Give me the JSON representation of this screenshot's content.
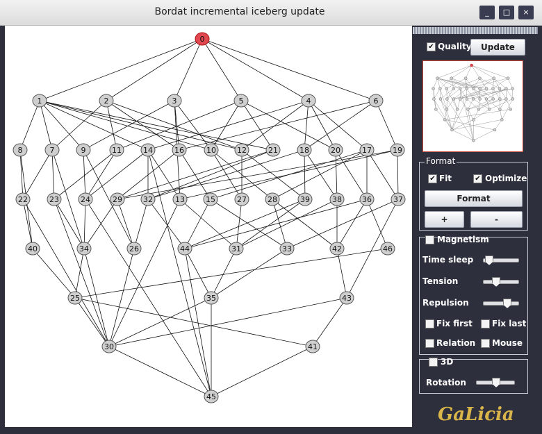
{
  "window": {
    "title": "Bordat incremental iceberg update"
  },
  "toolbar": {
    "quality_label": "Quality",
    "quality_checked": true,
    "update_label": "Update"
  },
  "format": {
    "legend": "Format",
    "fit_label": "Fit",
    "fit_checked": true,
    "optimize_label": "Optimize",
    "optimize_checked": true,
    "format_button": "Format",
    "plus_button": "+",
    "minus_button": "-"
  },
  "magnetism": {
    "legend": "Magnetism",
    "checked": false,
    "time_sleep_label": "Time sleep",
    "time_sleep_value": 0.05,
    "tension_label": "Tension",
    "tension_value": 0.3,
    "repulsion_label": "Repulsion",
    "repulsion_value": 0.7,
    "fix_first_label": "Fix first",
    "fix_last_label": "Fix last",
    "relation_label": "Relation",
    "mouse_label": "Mouse"
  },
  "threed": {
    "legend": "3D",
    "checked": false,
    "rotation_label": "Rotation",
    "rotation_value": 0.5
  },
  "logo": "GaLicia",
  "colors": {
    "selected_node": "#e0474f",
    "node": "#cfcfcf",
    "panel_bg": "#2d2f3c"
  },
  "lattice": {
    "levels": [
      [
        "0"
      ],
      [
        "1",
        "2",
        "3",
        "5",
        "4",
        "6"
      ],
      [
        "8",
        "7",
        "9",
        "11",
        "14",
        "16",
        "10",
        "12",
        "21",
        "18",
        "20",
        "17",
        "19"
      ],
      [
        "22",
        "23",
        "24",
        "29",
        "32",
        "13",
        "15",
        "27",
        "28",
        "39",
        "38",
        "36",
        "37"
      ],
      [
        "40",
        "34",
        "26",
        "44",
        "31",
        "33",
        "42",
        "46"
      ],
      [
        "25",
        "35",
        "43"
      ],
      [
        "30",
        "41"
      ],
      [
        "45"
      ]
    ],
    "selected": "0",
    "edges": [
      [
        "0",
        "1"
      ],
      [
        "0",
        "2"
      ],
      [
        "0",
        "3"
      ],
      [
        "0",
        "5"
      ],
      [
        "0",
        "4"
      ],
      [
        "0",
        "6"
      ],
      [
        "1",
        "8"
      ],
      [
        "1",
        "7"
      ],
      [
        "1",
        "9"
      ],
      [
        "1",
        "14"
      ],
      [
        "1",
        "10"
      ],
      [
        "1",
        "12"
      ],
      [
        "1",
        "21"
      ],
      [
        "2",
        "7"
      ],
      [
        "2",
        "11"
      ],
      [
        "2",
        "16"
      ],
      [
        "2",
        "12"
      ],
      [
        "3",
        "9"
      ],
      [
        "3",
        "16"
      ],
      [
        "3",
        "10"
      ],
      [
        "3",
        "13"
      ],
      [
        "5",
        "11"
      ],
      [
        "5",
        "10"
      ],
      [
        "5",
        "21"
      ],
      [
        "5",
        "20"
      ],
      [
        "4",
        "14"
      ],
      [
        "4",
        "12"
      ],
      [
        "4",
        "18"
      ],
      [
        "4",
        "20"
      ],
      [
        "4",
        "17"
      ],
      [
        "6",
        "16"
      ],
      [
        "6",
        "18"
      ],
      [
        "6",
        "19"
      ],
      [
        "8",
        "22"
      ],
      [
        "8",
        "40"
      ],
      [
        "7",
        "22"
      ],
      [
        "7",
        "23"
      ],
      [
        "7",
        "34"
      ],
      [
        "9",
        "24"
      ],
      [
        "9",
        "26"
      ],
      [
        "11",
        "23"
      ],
      [
        "11",
        "24"
      ],
      [
        "14",
        "24"
      ],
      [
        "14",
        "32"
      ],
      [
        "14",
        "13"
      ],
      [
        "16",
        "29"
      ],
      [
        "16",
        "15"
      ],
      [
        "10",
        "27"
      ],
      [
        "10",
        "28"
      ],
      [
        "12",
        "27"
      ],
      [
        "12",
        "39"
      ],
      [
        "21",
        "29"
      ],
      [
        "21",
        "32"
      ],
      [
        "18",
        "32"
      ],
      [
        "18",
        "39"
      ],
      [
        "18",
        "38"
      ],
      [
        "20",
        "38"
      ],
      [
        "20",
        "36"
      ],
      [
        "17",
        "28"
      ],
      [
        "17",
        "15"
      ],
      [
        "17",
        "36"
      ],
      [
        "17",
        "37"
      ],
      [
        "19",
        "37"
      ],
      [
        "19",
        "29"
      ],
      [
        "19",
        "13"
      ],
      [
        "22",
        "40"
      ],
      [
        "22",
        "30"
      ],
      [
        "23",
        "34"
      ],
      [
        "23",
        "30"
      ],
      [
        "24",
        "34"
      ],
      [
        "29",
        "34"
      ],
      [
        "29",
        "26"
      ],
      [
        "32",
        "44"
      ],
      [
        "32",
        "26"
      ],
      [
        "13",
        "31"
      ],
      [
        "13",
        "30"
      ],
      [
        "15",
        "44"
      ],
      [
        "15",
        "33"
      ],
      [
        "27",
        "31"
      ],
      [
        "28",
        "33"
      ],
      [
        "28",
        "42"
      ],
      [
        "39",
        "31"
      ],
      [
        "39",
        "44"
      ],
      [
        "38",
        "31"
      ],
      [
        "38",
        "42"
      ],
      [
        "36",
        "42"
      ],
      [
        "36",
        "46"
      ],
      [
        "36",
        "44"
      ],
      [
        "37",
        "33"
      ],
      [
        "37",
        "43"
      ],
      [
        "40",
        "25"
      ],
      [
        "34",
        "25"
      ],
      [
        "34",
        "30"
      ],
      [
        "26",
        "30"
      ],
      [
        "44",
        "35"
      ],
      [
        "44",
        "45"
      ],
      [
        "31",
        "35"
      ],
      [
        "33",
        "35"
      ],
      [
        "42",
        "43"
      ],
      [
        "46",
        "25"
      ],
      [
        "25",
        "30"
      ],
      [
        "25",
        "41"
      ],
      [
        "35",
        "30"
      ],
      [
        "35",
        "45"
      ],
      [
        "43",
        "41"
      ],
      [
        "43",
        "30"
      ],
      [
        "30",
        "45"
      ],
      [
        "41",
        "45"
      ],
      [
        "24",
        "45"
      ],
      [
        "14",
        "45"
      ]
    ]
  }
}
